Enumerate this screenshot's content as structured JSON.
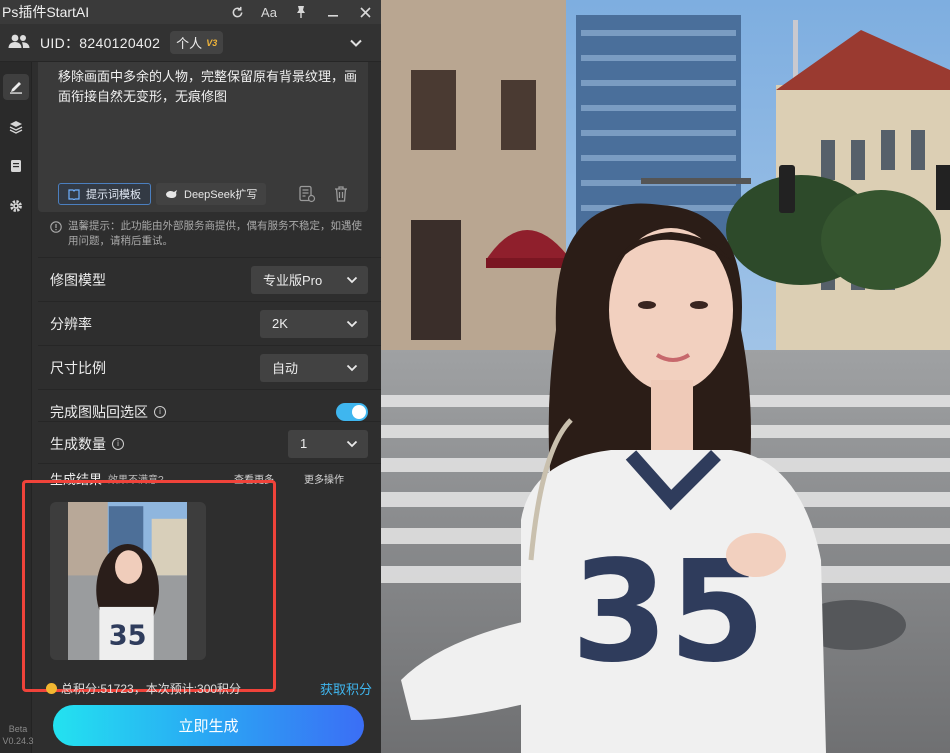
{
  "titlebar": {
    "app_title": "Ps插件StartAI",
    "font_icon_label": "Aa"
  },
  "user": {
    "uid_label": "UID：8240120402",
    "tier_label": "个人",
    "tier_badge": "V3"
  },
  "prompt": {
    "text": "移除画面中多余的人物，完整保留原有背景纹理，画面衔接自然无变形，无痕修图",
    "template_button": "提示词模板",
    "deepseek_button": "DeepSeek扩写"
  },
  "tip": {
    "text": "温馨提示：此功能由外部服务商提供，偶有服务不稳定，如遇使用问题，请稍后重试。"
  },
  "settings": {
    "model": {
      "label": "修图模型",
      "value": "专业版Pro"
    },
    "resolution": {
      "label": "分辨率",
      "value": "2K"
    },
    "ratio": {
      "label": "尺寸比例",
      "value": "自动"
    },
    "paste_back": {
      "label": "完成图贴回选区",
      "enabled": true
    },
    "count": {
      "label": "生成数量",
      "value": "1"
    }
  },
  "results": {
    "title": "生成结果",
    "subtitle": "效果不满意?",
    "view_more": "查看更多",
    "more_ops": "更多操作"
  },
  "points": {
    "text": "总积分:51723，本次预计:300积分",
    "get_points": "获取积分"
  },
  "generate_button": "立即生成",
  "version": {
    "line1": "Beta",
    "line2": "V0.24.3"
  },
  "colors": {
    "accent": "#3fb6ef",
    "highlight_frame": "#f0433a",
    "coin": "#f2b731"
  }
}
